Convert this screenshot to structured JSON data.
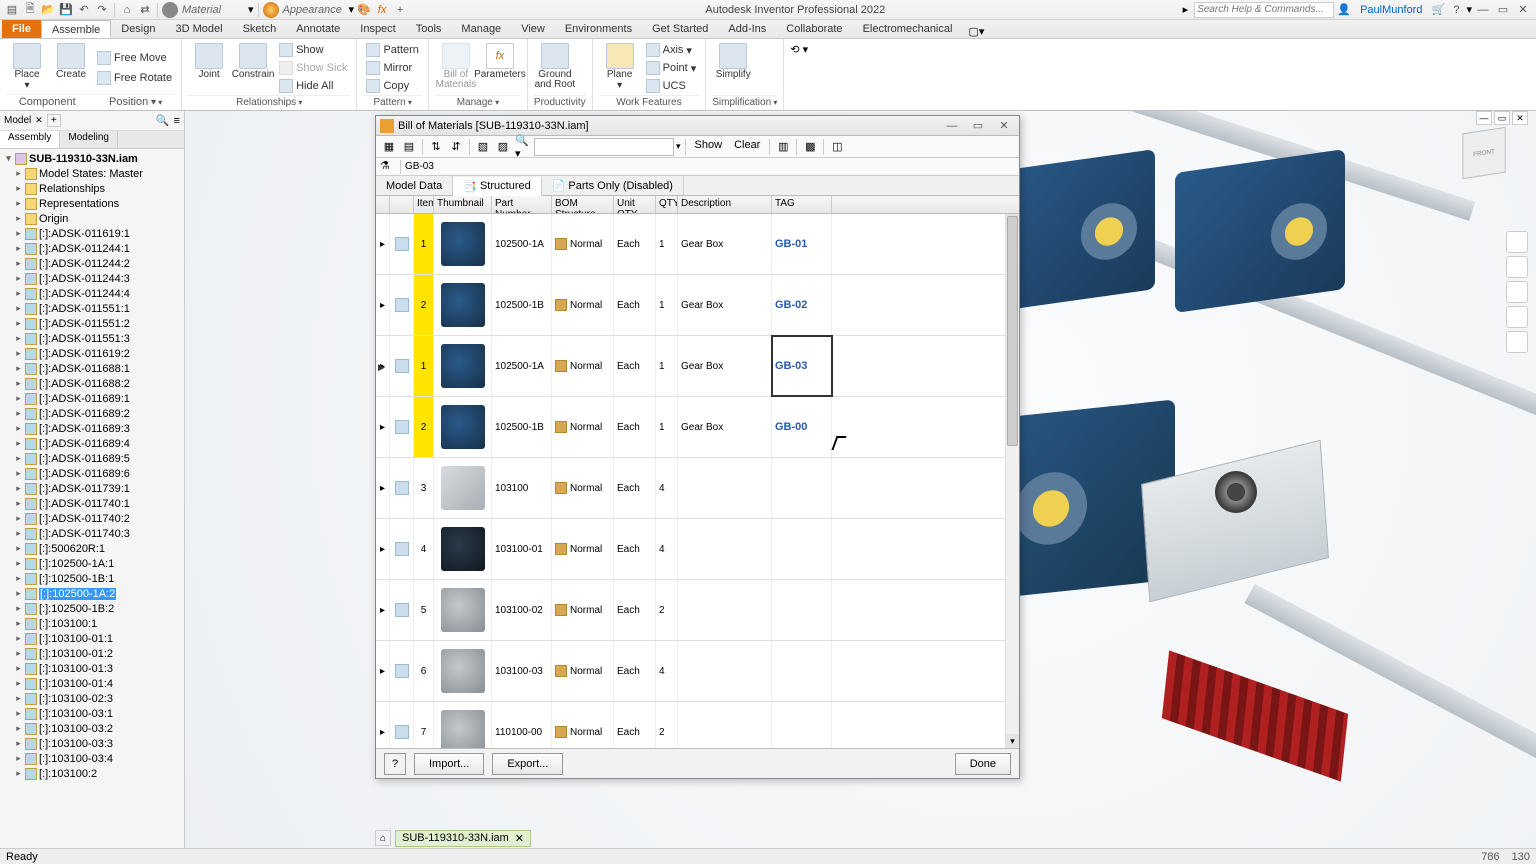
{
  "app": {
    "title": "Autodesk Inventor Professional 2022",
    "searchPlaceholder": "Search Help & Commands...",
    "user": "PaulMunford"
  },
  "qat": {
    "material": "Material",
    "appearance": "Appearance"
  },
  "ribbonTabs": [
    "File",
    "Assemble",
    "Design",
    "3D Model",
    "Sketch",
    "Annotate",
    "Inspect",
    "Tools",
    "Manage",
    "View",
    "Environments",
    "Get Started",
    "Add-Ins",
    "Collaborate",
    "Electromechanical"
  ],
  "ribbon": {
    "component": {
      "label": "Component",
      "place": "Place",
      "create": "Create",
      "freeMove": "Free Move",
      "freeRotate": "Free Rotate"
    },
    "position": {
      "label": "Position"
    },
    "relationships": {
      "label": "Relationships",
      "joint": "Joint",
      "constrain": "Constrain",
      "show": "Show",
      "showSick": "Show Sick",
      "hideAll": "Hide All"
    },
    "pattern": {
      "label": "Pattern",
      "pattern": "Pattern",
      "mirror": "Mirror",
      "copy": "Copy"
    },
    "manage": {
      "label": "Manage",
      "bom": "Bill of Materials",
      "params": "Parameters"
    },
    "productivity": {
      "label": "Productivity",
      "ground": "Ground and Root"
    },
    "workfeat": {
      "label": "Work Features",
      "plane": "Plane",
      "axis": "Axis",
      "point": "Point",
      "ucs": "UCS"
    },
    "simplification": {
      "label": "Simplification",
      "simplify": "Simplify"
    }
  },
  "browser": {
    "tab": "Model",
    "modes": [
      "Assembly",
      "Modeling"
    ],
    "root": "SUB-119310-33N.iam",
    "folders": [
      "Model States: Master",
      "Relationships",
      "Representations",
      "Origin"
    ],
    "nodes": [
      "[:]:ADSK-011619:1",
      "[:]:ADSK-011244:1",
      "[:]:ADSK-011244:2",
      "[:]:ADSK-011244:3",
      "[:]:ADSK-011244:4",
      "[:]:ADSK-011551:1",
      "[:]:ADSK-011551:2",
      "[:]:ADSK-011551:3",
      "[:]:ADSK-011619:2",
      "[:]:ADSK-011688:1",
      "[:]:ADSK-011688:2",
      "[:]:ADSK-011689:1",
      "[:]:ADSK-011689:2",
      "[:]:ADSK-011689:3",
      "[:]:ADSK-011689:4",
      "[:]:ADSK-011689:5",
      "[:]:ADSK-011689:6",
      "[:]:ADSK-011739:1",
      "[:]:ADSK-011740:1",
      "[:]:ADSK-011740:2",
      "[:]:ADSK-011740:3",
      "[:]:500620R:1",
      "[:]:102500-1A:1",
      "[:]:102500-1B:1",
      "[:]:102500-1A:2",
      "[:]:102500-1B:2",
      "[:]:103100:1",
      "[:]:103100-01:1",
      "[:]:103100-01:2",
      "[:]:103100-01:3",
      "[:]:103100-01:4",
      "[:]:103100-02:3",
      "[:]:103100-03:1",
      "[:]:103100-03:2",
      "[:]:103100-03:3",
      "[:]:103100-03:4",
      "[:]:103100:2"
    ],
    "selected": "[:]:102500-1A:2"
  },
  "docTab": {
    "name": "SUB-119310-33N.iam"
  },
  "status": {
    "text": "Ready",
    "x": "786",
    "y": "130"
  },
  "bom": {
    "title": "Bill of Materials [SUB-119310-33N.iam]",
    "show": "Show",
    "clear": "Clear",
    "filterValue": "GB-03",
    "tabs": {
      "modelData": "Model Data",
      "structured": "Structured",
      "partsOnly": "Parts Only (Disabled)"
    },
    "columns": [
      "",
      "",
      "Item",
      "Thumbnail",
      "Part Number",
      "BOM Structure",
      "Unit QTY",
      "QTY",
      "Description",
      "TAG"
    ],
    "rows": [
      {
        "item": "1",
        "hl": true,
        "thumb": "blue",
        "part": "102500-1A",
        "struct": "Normal",
        "uqty": "Each",
        "qty": "1",
        "desc": "Gear Box",
        "tag": "GB-01"
      },
      {
        "item": "2",
        "hl": true,
        "thumb": "blue",
        "part": "102500-1B",
        "struct": "Normal",
        "uqty": "Each",
        "qty": "1",
        "desc": "Gear Box",
        "tag": "GB-02"
      },
      {
        "item": "1",
        "hl": true,
        "thumb": "blue",
        "part": "102500-1A",
        "struct": "Normal",
        "uqty": "Each",
        "qty": "1",
        "desc": "Gear Box",
        "tag": "GB-03",
        "sel": true,
        "ptr": true
      },
      {
        "item": "2",
        "hl": true,
        "thumb": "blue",
        "part": "102500-1B",
        "struct": "Normal",
        "uqty": "Each",
        "qty": "1",
        "desc": "Gear Box",
        "tag": "GB-00"
      },
      {
        "item": "3",
        "thumb": "longgrey",
        "part": "103100",
        "struct": "Normal",
        "uqty": "Each",
        "qty": "4",
        "desc": "",
        "tag": ""
      },
      {
        "item": "4",
        "thumb": "dark",
        "part": "103100-01",
        "struct": "Normal",
        "uqty": "Each",
        "qty": "4",
        "desc": "",
        "tag": ""
      },
      {
        "item": "5",
        "thumb": "grey",
        "part": "103100-02",
        "struct": "Normal",
        "uqty": "Each",
        "qty": "2",
        "desc": "",
        "tag": ""
      },
      {
        "item": "6",
        "thumb": "grey",
        "part": "103100-03",
        "struct": "Normal",
        "uqty": "Each",
        "qty": "4",
        "desc": "",
        "tag": ""
      },
      {
        "item": "7",
        "thumb": "grey",
        "part": "110100-00",
        "struct": "Normal",
        "uqty": "Each",
        "qty": "2",
        "desc": "",
        "tag": ""
      }
    ],
    "footer": {
      "import": "Import...",
      "export": "Export...",
      "done": "Done"
    }
  },
  "viewcube": "FRONT"
}
